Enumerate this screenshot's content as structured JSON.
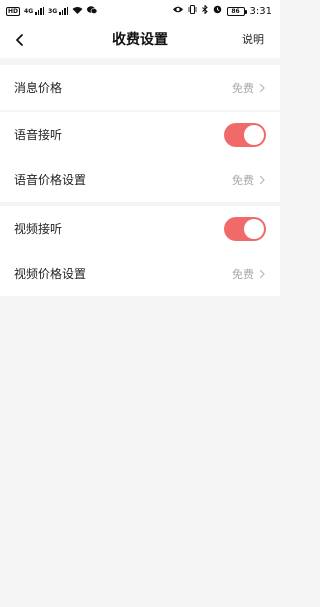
{
  "status_bar": {
    "left_icons": [
      "hd-icon",
      "signal-4g-icon",
      "signal-3g-icon",
      "wifi-icon",
      "wechat-icon"
    ],
    "right_icons": [
      "eye-icon",
      "vibrate-icon",
      "bluetooth-icon",
      "alarm-icon"
    ],
    "hd_label": "HD",
    "sig1_label": "4G",
    "sig2_label": "3G",
    "battery": "86",
    "time": "3:31"
  },
  "header": {
    "title": "收费设置",
    "help_label": "说明"
  },
  "sections": {
    "message": {
      "label": "消息价格",
      "value": "免费"
    },
    "voice": {
      "toggle_label": "语音接听",
      "toggle_on": true,
      "price_label": "语音价格设置",
      "price_value": "免费"
    },
    "video": {
      "toggle_label": "视频接听",
      "toggle_on": true,
      "price_label": "视频价格设置",
      "price_value": "免费"
    }
  },
  "colors": {
    "accent": "#f06a6a",
    "background": "#f5f5f5",
    "value_text": "#a8a8a8"
  }
}
